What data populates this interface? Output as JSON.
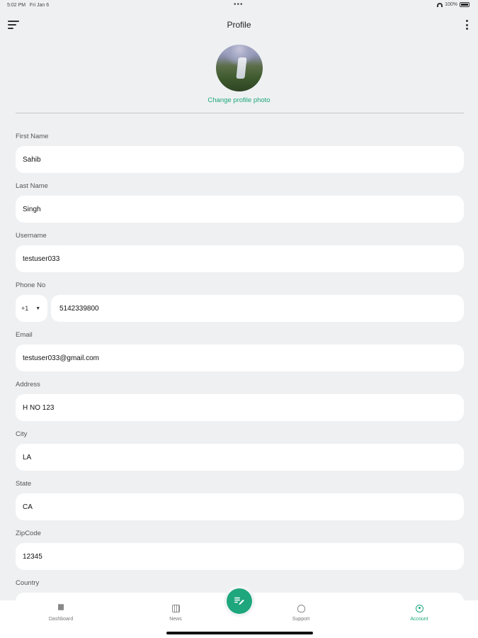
{
  "status_bar": {
    "time": "5:02 PM",
    "date": "Fri Jan 6",
    "battery": "100%",
    "dots": "•••"
  },
  "header": {
    "title": "Profile"
  },
  "profile": {
    "change_photo_label": "Change profile photo"
  },
  "fields": {
    "first_name": {
      "label": "First Name",
      "value": "Sahib"
    },
    "last_name": {
      "label": "Last Name",
      "value": "Singh"
    },
    "username": {
      "label": "Username",
      "value": "testuser033"
    },
    "phone": {
      "label": "Phone No",
      "country_code": "+1",
      "value": "5142339800"
    },
    "email": {
      "label": "Email",
      "value": "testuser033@gmail.com"
    },
    "address": {
      "label": "Address",
      "value": "H NO 123"
    },
    "city": {
      "label": "City",
      "value": "LA"
    },
    "state": {
      "label": "State",
      "value": "CA"
    },
    "zipcode": {
      "label": "ZipCode",
      "value": "12345"
    },
    "country": {
      "label": "Country",
      "value": ""
    }
  },
  "bottom_nav": {
    "items": [
      {
        "label": "Dashboard",
        "icon": "dashboard-icon"
      },
      {
        "label": "News",
        "icon": "news-icon"
      },
      {
        "label": "Support",
        "icon": "support-icon"
      },
      {
        "label": "Account",
        "icon": "account-icon"
      }
    ],
    "active": "Account"
  },
  "colors": {
    "accent": "#1ea67c",
    "background": "#eef0f2"
  }
}
